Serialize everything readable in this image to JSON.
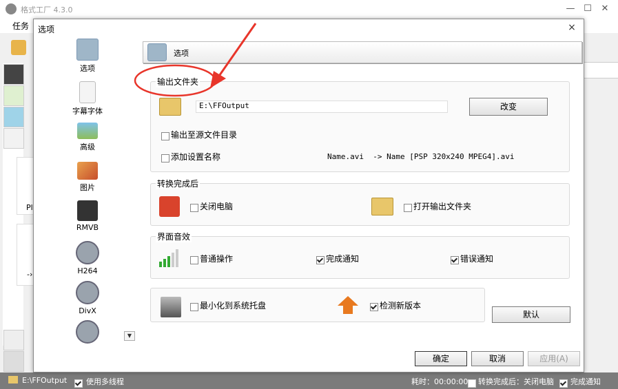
{
  "app": {
    "title": "格式工厂 4.3.0",
    "menu_task": "任务",
    "status_path": "E:\\FFOutput",
    "status_multithread": "使用多线程",
    "status_elapsed": "耗时：00:00:00",
    "status_after": "转换完成后：关闭电脑",
    "status_notify": "完成通知",
    "bg_text_1": "Pl",
    "bg_text_2": "-›"
  },
  "dialog": {
    "title": "选项",
    "close_glyph": "×",
    "header_title": "选项",
    "nav": [
      {
        "label": "选项",
        "icon": "options-gear-icon"
      },
      {
        "label": "字幕字体",
        "icon": "subtitle-font-icon"
      },
      {
        "label": "高级",
        "icon": "advanced-landscape-icon"
      },
      {
        "label": "图片",
        "icon": "picture-icon"
      },
      {
        "label": "RMVB",
        "icon": "rmvb-clapper-icon"
      },
      {
        "label": "H264",
        "icon": "h264-film-icon"
      },
      {
        "label": "DivX",
        "icon": "divx-film-icon"
      },
      {
        "label": "",
        "icon": "film-icon"
      }
    ],
    "output_folder": {
      "legend": "输出文件夹",
      "path": "E:\\FFOutput",
      "change_btn": "改变",
      "to_source_dir": "输出至源文件目录",
      "to_source_checked": false,
      "add_setting_name": "添加设置名称",
      "add_setting_checked": false,
      "example": "Name.avi  -> Name [PSP 320x240 MPEG4].avi"
    },
    "after_convert": {
      "legend": "转换完成后",
      "shutdown": "关闭电脑",
      "shutdown_checked": false,
      "open_folder": "打开输出文件夹",
      "open_folder_checked": false
    },
    "sound": {
      "legend": "界面音效",
      "normal": "普通操作",
      "normal_checked": false,
      "done": "完成通知",
      "done_checked": true,
      "error": "错误通知",
      "error_checked": true
    },
    "misc": {
      "minimize_tray": "最小化到系统托盘",
      "minimize_checked": false,
      "check_update": "检测新版本",
      "update_checked": true
    },
    "default_btn": "默认",
    "ok_btn": "确定",
    "cancel_btn": "取消",
    "apply_btn": "应用(A)"
  },
  "colors": {
    "statusbar": "#7b7b7b",
    "annotation_red": "#e8352a",
    "folder": "#e8c66a"
  }
}
